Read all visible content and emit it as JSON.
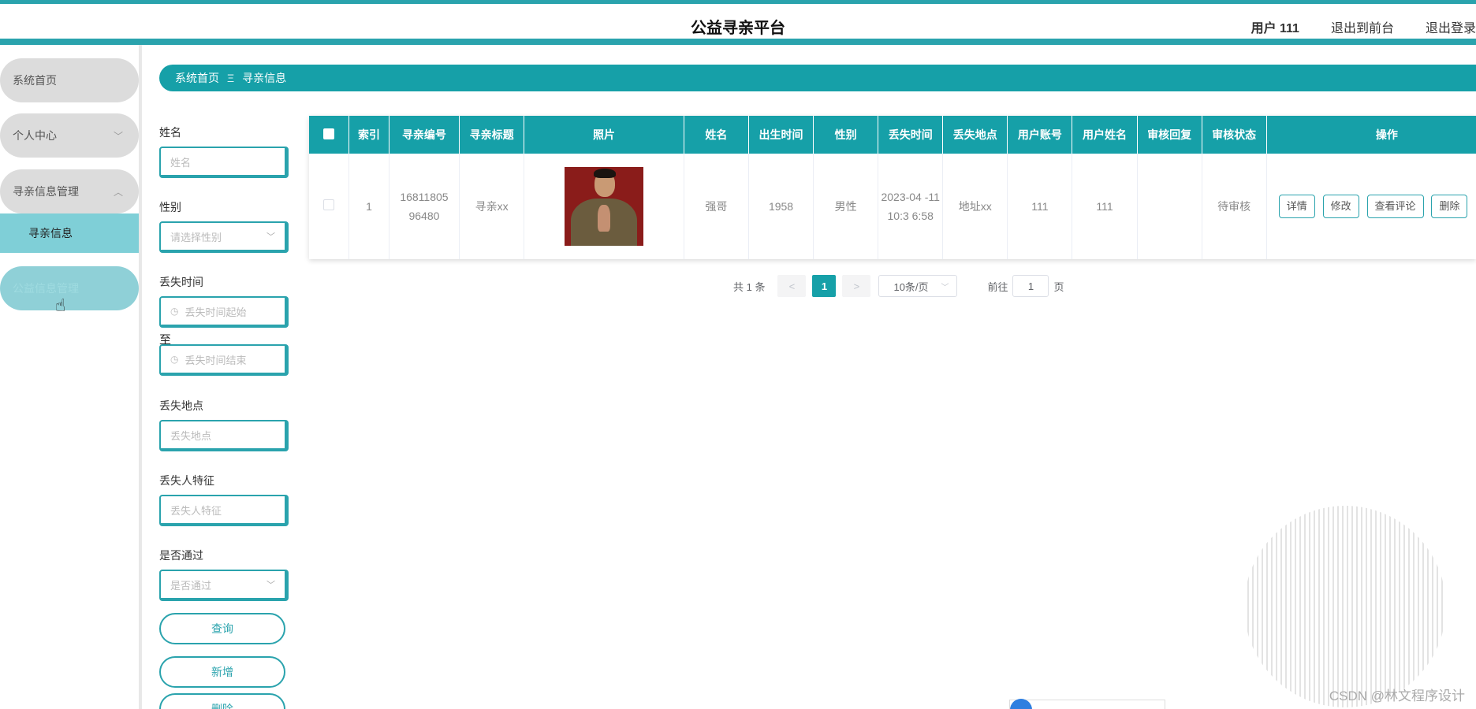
{
  "header": {
    "app_title": "公益寻亲平台",
    "user": "用户 111",
    "exit_front": "退出到前台",
    "logout": "退出登录"
  },
  "sidebar": {
    "items": [
      {
        "label": "系统首页"
      },
      {
        "label": "个人中心"
      },
      {
        "label": "寻亲信息管理"
      },
      {
        "label": "寻亲信息"
      },
      {
        "label": "公益信息管理"
      }
    ]
  },
  "breadcrumb": {
    "home": "系统首页",
    "separator": "Ξ",
    "current": "寻亲信息"
  },
  "filters": {
    "name_label": "姓名",
    "name_placeholder": "姓名",
    "gender_label": "性别",
    "gender_placeholder": "请选择性别",
    "lost_time_label": "丢失时间",
    "lost_time_start": "丢失时间起始",
    "to": "至",
    "lost_time_end": "丢失时间结束",
    "lost_place_label": "丢失地点",
    "lost_place_placeholder": "丢失地点",
    "feature_label": "丢失人特征",
    "feature_placeholder": "丢失人特征",
    "passed_label": "是否通过",
    "passed_placeholder": "是否通过",
    "query_button": "查询",
    "add_button": "新增",
    "delete_button": "删除"
  },
  "table": {
    "headers": [
      "索引",
      "寻亲编号",
      "寻亲标题",
      "照片",
      "姓名",
      "出生时间",
      "性别",
      "丢失时间",
      "丢失地点",
      "用户账号",
      "用户姓名",
      "审核回复",
      "审核状态",
      "操作"
    ],
    "row": {
      "index": "1",
      "number": "16811805 96480",
      "title": "寻亲xx",
      "name": "强哥",
      "birth": "1958",
      "gender": "男性",
      "lost_time": "2023-04 -11 10:3 6:58",
      "lost_place": "地址xx",
      "account": "111",
      "user_name": "111",
      "reply": "",
      "status": "待审核"
    },
    "actions": {
      "detail": "详情",
      "edit": "修改",
      "comments": "查看评论",
      "delete": "删除"
    }
  },
  "pagination": {
    "total": "共 1 条",
    "prev": "<",
    "page": "1",
    "next": ">",
    "page_size": "10条/页",
    "goto_label": "前往",
    "goto_value": "1",
    "page_suffix": "页"
  },
  "watermark": "CSDN @林文程序设计",
  "colors": {
    "accent": "#16a0a8",
    "sidebar_item": "#dcdcdc"
  }
}
